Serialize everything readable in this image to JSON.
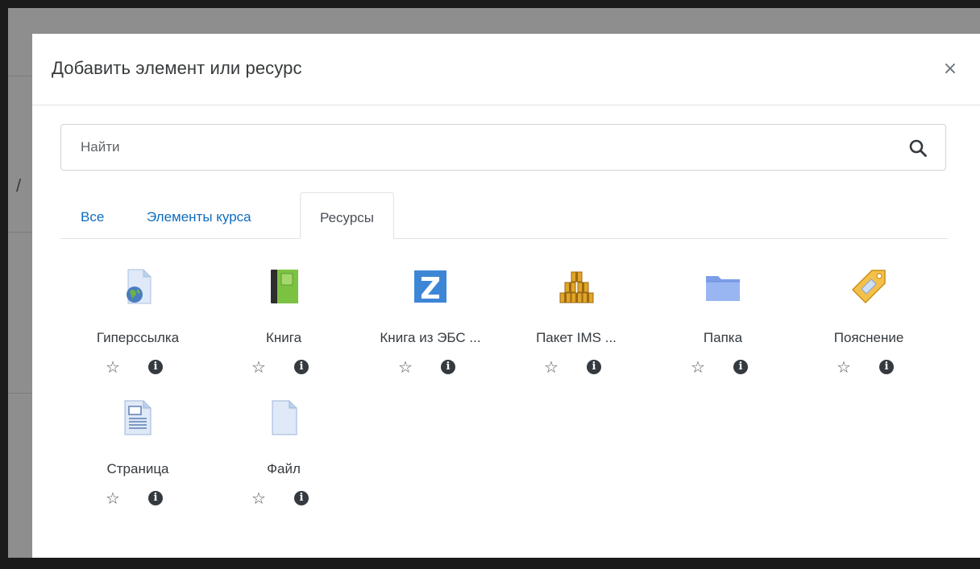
{
  "modal": {
    "title": "Добавить элемент или ресурс",
    "close_label": "×"
  },
  "search": {
    "placeholder": "Найти",
    "value": ""
  },
  "tabs": [
    {
      "label": "Все",
      "active": false
    },
    {
      "label": "Элементы курса",
      "active": false
    },
    {
      "label": "Ресурсы",
      "active": true
    }
  ],
  "items": [
    {
      "label": "Гиперссылка",
      "icon": "url-icon"
    },
    {
      "label": "Книга",
      "icon": "book-icon"
    },
    {
      "label": "Книга из ЭБС ...",
      "icon": "znanium-icon"
    },
    {
      "label": "Пакет IMS ...",
      "icon": "ims-package-icon"
    },
    {
      "label": "Папка",
      "icon": "folder-icon"
    },
    {
      "label": "Пояснение",
      "icon": "label-tag-icon"
    },
    {
      "label": "Страница",
      "icon": "page-icon"
    },
    {
      "label": "Файл",
      "icon": "file-icon"
    }
  ],
  "icons": {
    "star": "☆",
    "info": "i"
  },
  "colors": {
    "link": "#0f6cbf",
    "backdrop": "#8e8e8e"
  }
}
